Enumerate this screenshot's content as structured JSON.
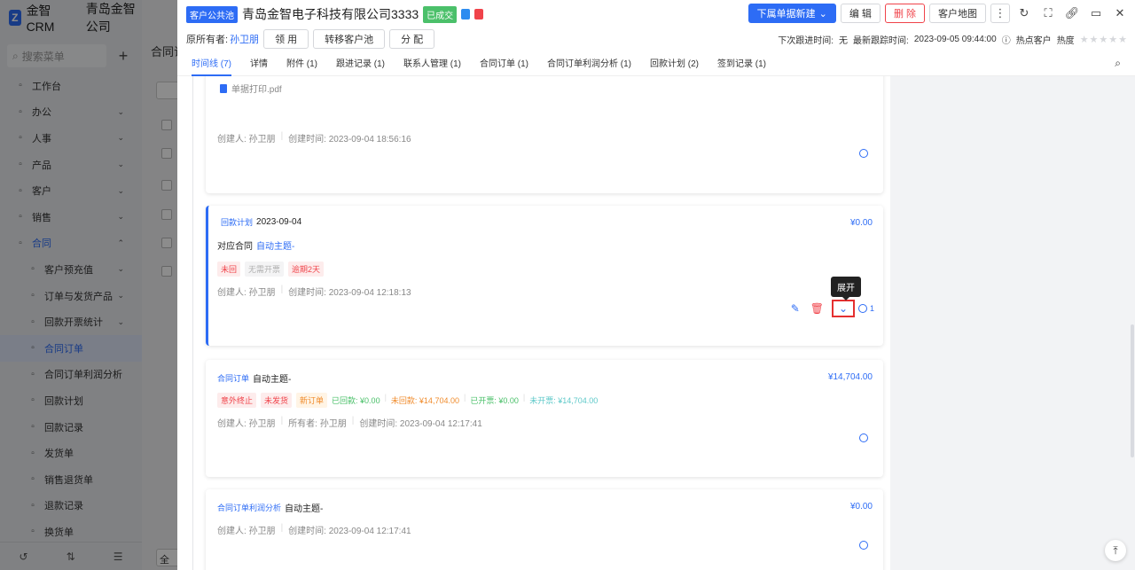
{
  "bg": {
    "logo_text": "金智CRM",
    "company": "青岛金智公司",
    "search_placeholder": "搜索菜单",
    "menu": [
      {
        "label": "工作台",
        "icon": "dashboard-icon",
        "arrow": false,
        "sub": false
      },
      {
        "label": "办公",
        "icon": "office-icon",
        "arrow": true,
        "sub": false
      },
      {
        "label": "人事",
        "icon": "person-icon",
        "arrow": true,
        "sub": false
      },
      {
        "label": "产品",
        "icon": "product-icon",
        "arrow": true,
        "sub": false
      },
      {
        "label": "客户",
        "icon": "customer-icon",
        "arrow": true,
        "sub": false
      },
      {
        "label": "销售",
        "icon": "sales-icon",
        "arrow": true,
        "sub": false
      },
      {
        "label": "合同",
        "icon": "contract-icon",
        "arrow": true,
        "sub": false,
        "active": true
      },
      {
        "label": "客户预充值",
        "icon": "doc-icon",
        "arrow": true,
        "sub": true
      },
      {
        "label": "订单与发货产品",
        "icon": "doc-icon",
        "arrow": true,
        "sub": true
      },
      {
        "label": "回款开票统计",
        "icon": "doc-icon",
        "arrow": true,
        "sub": true
      },
      {
        "label": "合同订单",
        "icon": "doc-icon",
        "arrow": false,
        "sub": true,
        "current": true
      },
      {
        "label": "合同订单利润分析",
        "icon": "doc-icon",
        "arrow": false,
        "sub": true
      },
      {
        "label": "回款计划",
        "icon": "doc-icon",
        "arrow": false,
        "sub": true
      },
      {
        "label": "回款记录",
        "icon": "doc-icon",
        "arrow": false,
        "sub": true
      },
      {
        "label": "发货单",
        "icon": "doc-icon",
        "arrow": false,
        "sub": true
      },
      {
        "label": "销售退货单",
        "icon": "doc-icon",
        "arrow": false,
        "sub": true
      },
      {
        "label": "退款记录",
        "icon": "doc-icon",
        "arrow": false,
        "sub": true
      },
      {
        "label": "换货单",
        "icon": "doc-icon",
        "arrow": false,
        "sub": true
      }
    ],
    "main_title": "合同订",
    "main_footer": "全"
  },
  "header": {
    "pool_tag": "客户公共池",
    "customer_name": "青岛金智电子科技有限公司3333",
    "status_tag": "已成交",
    "primary_button": "下属单据新建",
    "edit_button": "编 辑",
    "delete_button": "删 除",
    "map_button": "客户地图",
    "owner_label": "原所有者:",
    "owner_value": "孙卫朋",
    "claim_button": "领 用",
    "transfer_button": "转移客户池",
    "assign_button": "分 配",
    "next_followup_label": "下次跟进时间:",
    "next_followup_value": "无",
    "last_followup_label": "最新跟踪时间:",
    "last_followup_value": "2023-09-05 09:44:00",
    "hot_customer": "热点客户",
    "heat_label": "热度",
    "heat_stars": "★★★★★"
  },
  "tabs": [
    {
      "label": "时间线 (7)",
      "active": true
    },
    {
      "label": "详情"
    },
    {
      "label": "附件 (1)"
    },
    {
      "label": "跟进记录 (1)"
    },
    {
      "label": "联系人管理 (1)"
    },
    {
      "label": "合同订单 (1)"
    },
    {
      "label": "合同订单利润分析 (1)"
    },
    {
      "label": "回款计划 (2)"
    },
    {
      "label": "签到记录 (1)"
    }
  ],
  "cards": {
    "c1": {
      "attachment": "单据打印.pdf",
      "creator": "创建人: 孙卫朋",
      "created": "创建时间: 2023-09-04 18:56:16"
    },
    "c2": {
      "type": "回款计划",
      "title": "2023-09-04",
      "amount": "¥0.00",
      "contract_label": "对应合同",
      "contract_link": "自动主题-",
      "tags": [
        "未回",
        "无需开票",
        "逾期2天"
      ],
      "creator": "创建人: 孙卫朋",
      "created": "创建时间: 2023-09-04 12:18:13",
      "comment_count": "1",
      "tooltip": "展开"
    },
    "c3": {
      "type": "合同订单",
      "title": "自动主题-",
      "amount": "¥14,704.00",
      "tags": [
        "意外终止",
        "未发货",
        "新订单"
      ],
      "received": "已回款: ¥0.00",
      "unreceived": "未回款: ¥14,704.00",
      "invoiced": "已开票: ¥0.00",
      "uninvoiced": "未开票: ¥14,704.00",
      "creator": "创建人: 孙卫朋",
      "owner": "所有者: 孙卫朋",
      "created": "创建时间: 2023-09-04 12:17:41"
    },
    "c4": {
      "type": "合同订单利润分析",
      "title": "自动主题-",
      "amount": "¥0.00",
      "creator": "创建人: 孙卫朋",
      "created": "创建时间: 2023-09-04 12:17:41"
    }
  }
}
